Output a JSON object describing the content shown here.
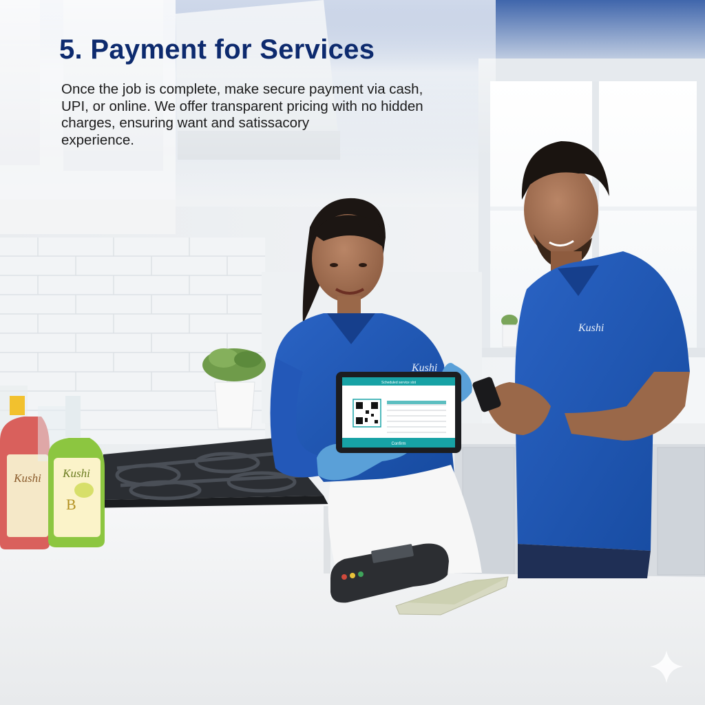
{
  "header": {
    "title": "5. Payment for Services",
    "body_lines": [
      "Once the job is complete, make secure payment via cash,",
      "UPI, or online.  We offer transparent pricing with no hidden",
      "charges, ensuring want and satissacory",
      "experience."
    ]
  },
  "branding": {
    "logo_text": "Kushi",
    "bottle_label_2_text": "B",
    "tablet_header_text": "Scheduled service slot",
    "tablet_footer_text": "Confirm"
  },
  "colors": {
    "title": "#0d2a6e",
    "uniform": "#1f55b5",
    "glove": "#5aa0d8",
    "tablet_teal": "#17a2a5",
    "counter": "#f4f5f6",
    "cabinet": "#f7f8f9"
  },
  "icons": [
    "sparkle-icon",
    "qr-code-icon"
  ]
}
